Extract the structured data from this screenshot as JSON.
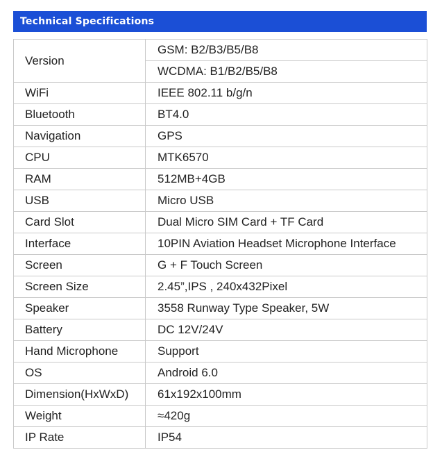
{
  "header": {
    "title": "Technical Specifications"
  },
  "colors": {
    "header_bg": "#1b4fd6",
    "header_text": "#ffffff",
    "border": "#c9c9c9",
    "text": "#222222"
  },
  "specs": [
    {
      "label": "Version",
      "values": [
        "GSM: B2/B3/B5/B8",
        "WCDMA: B1/B2/B5/B8"
      ]
    },
    {
      "label": "WiFi",
      "values": [
        "IEEE 802.11  b/g/n"
      ]
    },
    {
      "label": "Bluetooth",
      "values": [
        "BT4.0"
      ]
    },
    {
      "label": "Navigation",
      "values": [
        "GPS"
      ]
    },
    {
      "label": "CPU",
      "values": [
        "MTK6570"
      ]
    },
    {
      "label": "RAM",
      "values": [
        "512MB+4GB"
      ]
    },
    {
      "label": "USB",
      "values": [
        "Micro USB"
      ]
    },
    {
      "label": "Card Slot",
      "values": [
        "Dual Micro SIM Card + TF Card"
      ]
    },
    {
      "label": "Interface",
      "values": [
        "10PIN Aviation Headset Microphone Interface"
      ]
    },
    {
      "label": "Screen",
      "values": [
        "G + F Touch Screen"
      ]
    },
    {
      "label": "Screen Size",
      "values": [
        "2.45”,IPS , 240x432Pixel"
      ]
    },
    {
      "label": "Speaker",
      "values": [
        "3558 Runway Type Speaker, 5W"
      ]
    },
    {
      "label": "Battery",
      "values": [
        "DC 12V/24V"
      ]
    },
    {
      "label": "Hand Microphone",
      "values": [
        "Support"
      ]
    },
    {
      "label": "OS",
      "values": [
        "Android 6.0"
      ]
    },
    {
      "label": "Dimension(HxWxD)",
      "values": [
        "61x192x100mm"
      ]
    },
    {
      "label": "Weight",
      "values": [
        "≈420g"
      ]
    },
    {
      "label": "IP Rate",
      "values": [
        "IP54"
      ]
    }
  ]
}
